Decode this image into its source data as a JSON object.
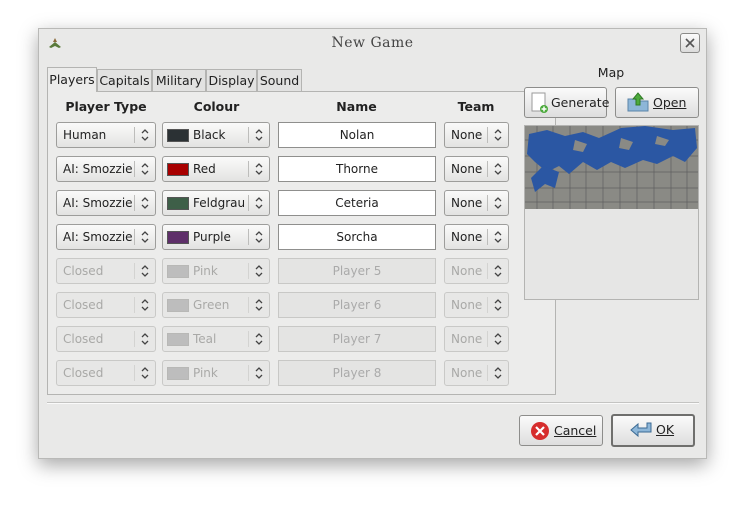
{
  "window": {
    "title": "New Game"
  },
  "tabs": [
    "Players",
    "Capitals",
    "Military",
    "Display",
    "Sound"
  ],
  "columns": {
    "player_type": "Player Type",
    "colour": "Colour",
    "name": "Name",
    "team": "Team"
  },
  "players": [
    {
      "type": "Human",
      "colour": "Black",
      "swatch": "#2b3134",
      "name": "Nolan",
      "team": "None",
      "enabled": true
    },
    {
      "type": "AI: Smozzie",
      "colour": "Red",
      "swatch": "#a80000",
      "name": "Thorne",
      "team": "None",
      "enabled": true
    },
    {
      "type": "AI: Smozzie",
      "colour": "Feldgrau",
      "swatch": "#3e5f48",
      "name": "Ceteria",
      "team": "None",
      "enabled": true
    },
    {
      "type": "AI: Smozzie",
      "colour": "Purple",
      "swatch": "#5e2f69",
      "name": "Sorcha",
      "team": "None",
      "enabled": true
    },
    {
      "type": "Closed",
      "colour": "Pink",
      "swatch": "#bdbdbd",
      "name": "Player 5",
      "team": "None",
      "enabled": false
    },
    {
      "type": "Closed",
      "colour": "Green",
      "swatch": "#bdbdbd",
      "name": "Player 6",
      "team": "None",
      "enabled": false
    },
    {
      "type": "Closed",
      "colour": "Teal",
      "swatch": "#bdbdbd",
      "name": "Player 7",
      "team": "None",
      "enabled": false
    },
    {
      "type": "Closed",
      "colour": "Pink",
      "swatch": "#bdbdbd",
      "name": "Player 8",
      "team": "None",
      "enabled": false
    }
  ],
  "map": {
    "label": "Map",
    "generate_label": "Generate",
    "open_label": "Open",
    "water_color": "#2b57a3",
    "land_color": "#8a8a85"
  },
  "footer": {
    "cancel_label": "Cancel",
    "ok_label": "OK"
  }
}
